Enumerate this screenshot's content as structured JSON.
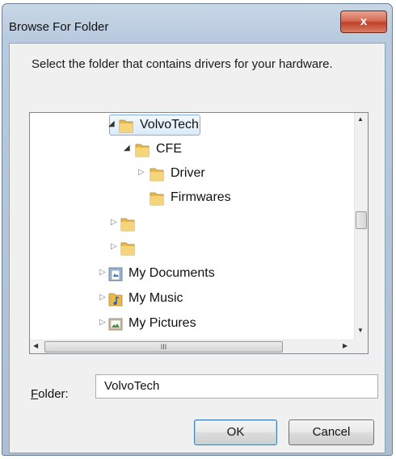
{
  "window": {
    "title": "Browse For Folder",
    "close_label": "x"
  },
  "description": "Select the folder that contains drivers for your hardware.",
  "tree": {
    "items": [
      {
        "label": "VolvoTech",
        "icon": "folder-icon",
        "expander": "expanded",
        "selected": true
      },
      {
        "label": "CFE",
        "icon": "folder-icon",
        "expander": "expanded"
      },
      {
        "label": "Driver",
        "icon": "folder-icon",
        "expander": "collapsed"
      },
      {
        "label": "Firmwares",
        "icon": "folder-icon",
        "expander": "none"
      },
      {
        "label": "",
        "icon": "folder-icon",
        "expander": "collapsed"
      },
      {
        "label": "",
        "icon": "folder-icon",
        "expander": "collapsed"
      },
      {
        "label": "My Documents",
        "icon": "documents-library-icon",
        "expander": "collapsed"
      },
      {
        "label": "My Music",
        "icon": "music-library-icon",
        "expander": "collapsed"
      },
      {
        "label": "My Pictures",
        "icon": "pictures-library-icon",
        "expander": "collapsed"
      }
    ],
    "hscroll_grip": "III"
  },
  "folder_field": {
    "label_prefix": "F",
    "label_rest": "older:",
    "value": "VolvoTech"
  },
  "buttons": {
    "ok": "OK",
    "cancel": "Cancel"
  },
  "colors": {
    "selection_border": "#84acdd",
    "close_button": "#c9503a"
  }
}
